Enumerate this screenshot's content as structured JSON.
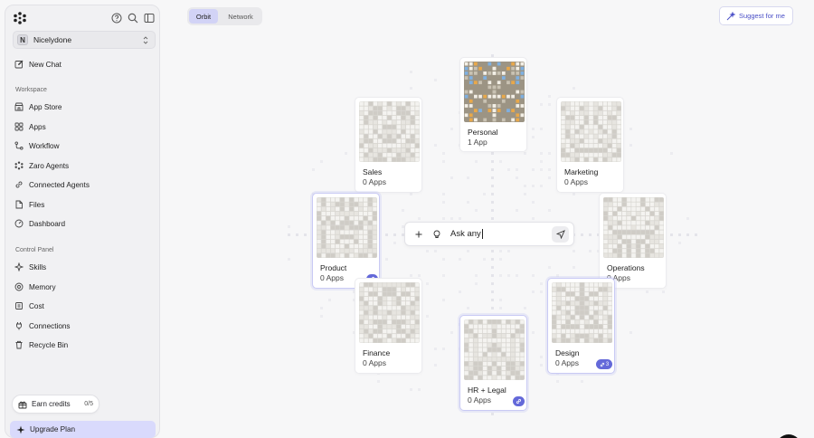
{
  "sidebar": {
    "workspace_badge": "N",
    "workspace_name": "Nicelydone",
    "new_chat": "New Chat",
    "sections": {
      "workspace": "Workspace",
      "control_panel": "Control Panel"
    },
    "workspace_items": [
      "App Store",
      "Apps",
      "Workflow",
      "Zaro Agents",
      "Connected Agents",
      "Files",
      "Dashboard"
    ],
    "control_items": [
      "Skills",
      "Memory",
      "Cost",
      "Connections",
      "Recycle Bin"
    ],
    "earn_credits": "Earn credits",
    "earn_count": "0/5",
    "upgrade": "Upgrade Plan"
  },
  "tabs": [
    "Orbit",
    "Network"
  ],
  "active_tab": "Orbit",
  "suggest_button": "Suggest for me",
  "ask": {
    "value": "Ask any"
  },
  "cards": [
    {
      "id": "personal",
      "title": "Personal",
      "sub": "1 App"
    },
    {
      "id": "sales",
      "title": "Sales",
      "sub": "0 Apps"
    },
    {
      "id": "marketing",
      "title": "Marketing",
      "sub": "0 Apps"
    },
    {
      "id": "product",
      "title": "Product",
      "sub": "0 Apps"
    },
    {
      "id": "operations",
      "title": "Operations",
      "sub": "0 Apps"
    },
    {
      "id": "finance",
      "title": "Finance",
      "sub": "0 Apps"
    },
    {
      "id": "hr",
      "title": "HR + Legal",
      "sub": "0 Apps"
    },
    {
      "id": "design",
      "title": "Design",
      "sub": "0 Apps",
      "badge": "3"
    }
  ],
  "colors": {
    "accent": "#6469d9",
    "selected_tab": "#d2d3f6",
    "upgrade_bg": "#d9dafc",
    "personal_thumb": "#9c9484"
  }
}
